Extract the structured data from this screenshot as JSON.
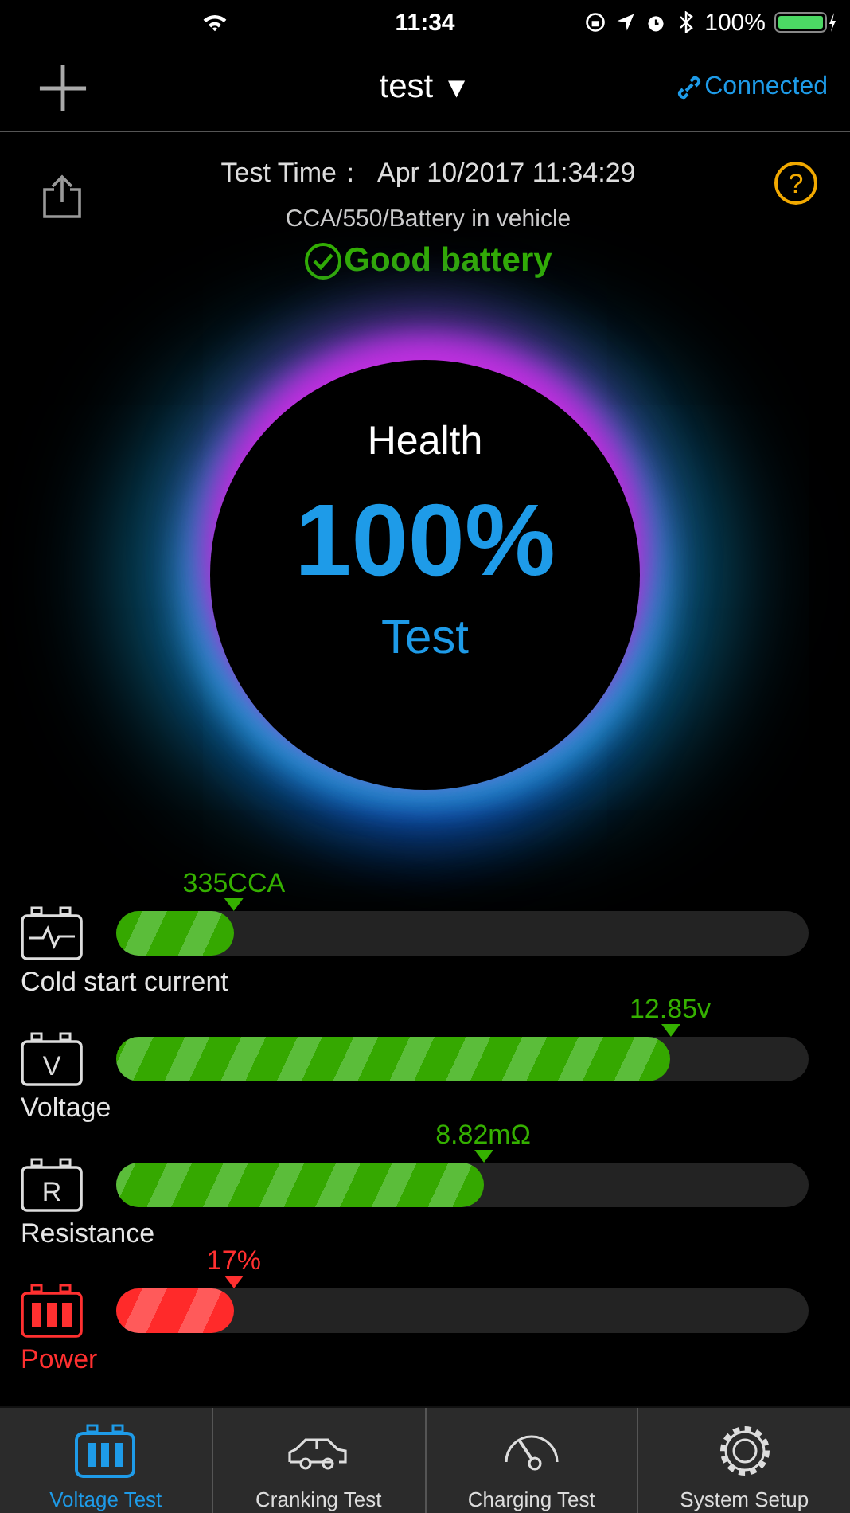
{
  "status_bar": {
    "time": "11:34",
    "battery": "100%"
  },
  "nav": {
    "title": "test",
    "title_caret": "▼",
    "connection": "Connected"
  },
  "result": {
    "test_time": "Test Time：  Apr 10/2017 11:34:29",
    "details": "CCA/550/Battery in vehicle",
    "verdict": "Good battery",
    "help": "?"
  },
  "gauge": {
    "label": "Health",
    "value": "100%",
    "action": "Test"
  },
  "metrics": [
    {
      "kind": "cca",
      "name": "Cold start current",
      "reading": "335CCA",
      "level": 0.17,
      "warning": false
    },
    {
      "kind": "voltage",
      "icon_letter": "V",
      "name": "Voltage",
      "reading": "12.85v",
      "level": 0.8,
      "warning": false
    },
    {
      "kind": "resistance",
      "icon_letter": "R",
      "name": "Resistance",
      "reading": "8.82mΩ",
      "level": 0.53,
      "warning": false
    },
    {
      "kind": "power",
      "name": "Power",
      "reading": "17%",
      "level": 0.17,
      "warning": true
    }
  ],
  "tabs": [
    {
      "kind": "battery",
      "label": "Voltage Test",
      "selected": true
    },
    {
      "kind": "car",
      "label": "Cranking Test",
      "selected": false
    },
    {
      "kind": "gauge",
      "label": "Charging Test",
      "selected": false
    },
    {
      "kind": "gear",
      "label": "System Setup",
      "selected": false
    }
  ]
}
